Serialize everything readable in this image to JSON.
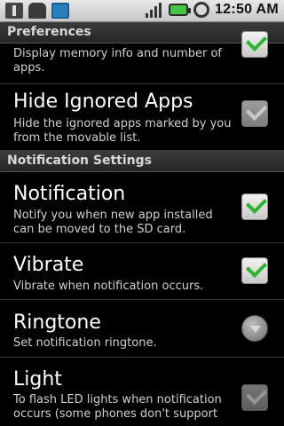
{
  "status_bar": {
    "left_icons": [
      "usb-icon",
      "android-icon",
      "trash-icon"
    ],
    "right_icons": [
      "signal-icon",
      "battery-icon",
      "alarm-icon"
    ],
    "time": "12:50 AM"
  },
  "preferences": {
    "header": "Preferences",
    "clipped_item": {
      "summary": "Display memory info and number of apps."
    },
    "hide_ignored": {
      "title": "Hide Ignored Apps",
      "summary": "Hide the ignored apps marked by you from the movable list.",
      "checked": true
    }
  },
  "notification_settings": {
    "header": "Notification Settings",
    "notification": {
      "title": "Notification",
      "summary": "Notify you when new app installed can be moved to the SD card.",
      "checked": true
    },
    "vibrate": {
      "title": "Vibrate",
      "summary": "Vibrate when notification occurs.",
      "checked": true
    },
    "ringtone": {
      "title": "Ringtone",
      "summary": "Set notification ringtone."
    },
    "light": {
      "title": "Light",
      "summary": "To flash LED lights when notification occurs (some phones don't support",
      "checked": true
    }
  },
  "colors": {
    "check_green": "#2db52d",
    "background": "#000000",
    "header_bg": "#2d2d2d"
  }
}
